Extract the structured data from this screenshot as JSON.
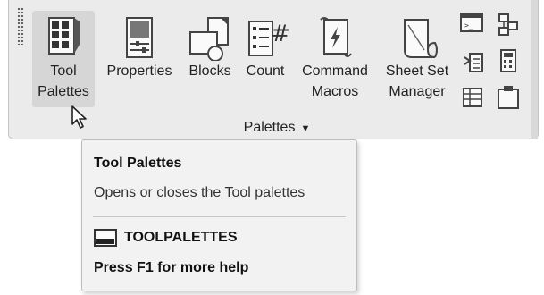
{
  "ribbon": {
    "tools": [
      {
        "line1": "Tool",
        "line2": "Palettes"
      },
      {
        "line1": "Properties",
        "line2": ""
      },
      {
        "line1": "Blocks",
        "line2": ""
      },
      {
        "line1": "Count",
        "line2": ""
      },
      {
        "line1": "Command",
        "line2": "Macros"
      },
      {
        "line1": "Sheet Set",
        "line2": "Manager"
      }
    ],
    "panel_label": "Palettes",
    "panel_arrow": "▼"
  },
  "tooltip": {
    "title": "Tool Palettes",
    "description": "Opens or closes the Tool palettes",
    "command": "TOOLPALETTES",
    "help": "Press F1 for more help"
  }
}
